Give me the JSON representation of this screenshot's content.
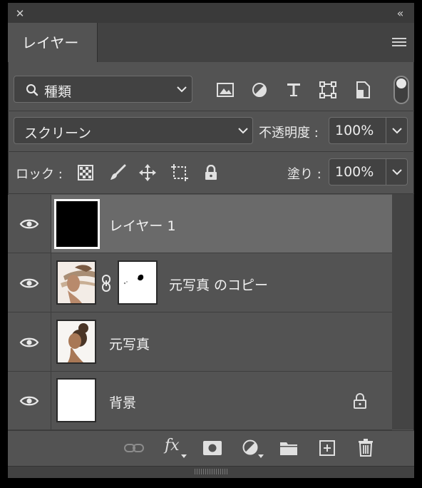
{
  "window": {
    "close_glyph": "✕",
    "collapse_glyph": "‹‹"
  },
  "panel": {
    "tab_label": "レイヤー"
  },
  "filter": {
    "selected": "種類"
  },
  "blend": {
    "mode": "スクリーン",
    "opacity_label": "不透明度 :",
    "opacity_value": "100%"
  },
  "lock": {
    "label": "ロック :",
    "fill_label": "塗り :",
    "fill_value": "100%"
  },
  "layers": [
    {
      "name": "レイヤー 1",
      "selected": true,
      "visible": true
    },
    {
      "name": "元写真 のコピー",
      "selected": false,
      "visible": true
    },
    {
      "name": "元写真",
      "selected": false,
      "visible": true
    },
    {
      "name": "背景",
      "selected": false,
      "visible": true,
      "locked": true
    }
  ],
  "bottom": {
    "fx_label": "fx"
  },
  "colors": {
    "panel_bg": "#535353",
    "selected_row": "#6a6a6a",
    "field_bg": "#424242"
  }
}
